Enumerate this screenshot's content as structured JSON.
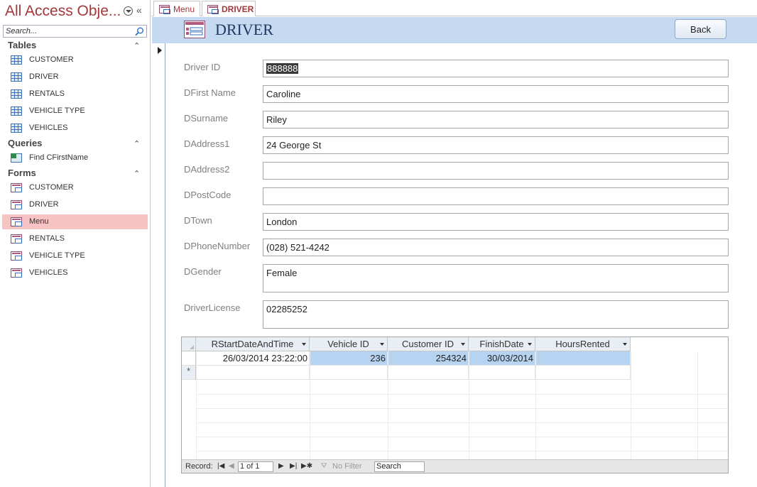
{
  "nav": {
    "title": "All Access Obje...",
    "search_placeholder": "Search...",
    "sections": [
      {
        "label": "Tables",
        "items": [
          {
            "label": "CUSTOMER",
            "icon": "table-icon"
          },
          {
            "label": "DRIVER",
            "icon": "table-icon"
          },
          {
            "label": "RENTALS",
            "icon": "table-icon"
          },
          {
            "label": "VEHICLE TYPE",
            "icon": "table-icon"
          },
          {
            "label": "VEHICLES",
            "icon": "table-icon"
          }
        ]
      },
      {
        "label": "Queries",
        "items": [
          {
            "label": "Find CFirstName",
            "icon": "query-icon"
          }
        ]
      },
      {
        "label": "Forms",
        "items": [
          {
            "label": "CUSTOMER",
            "icon": "form-icon"
          },
          {
            "label": "DRIVER",
            "icon": "form-icon"
          },
          {
            "label": "Menu",
            "icon": "form-icon",
            "selected": true
          },
          {
            "label": "RENTALS",
            "icon": "form-icon"
          },
          {
            "label": "VEHICLE TYPE",
            "icon": "form-icon"
          },
          {
            "label": "VEHICLES",
            "icon": "form-icon"
          }
        ]
      }
    ]
  },
  "tabs": [
    {
      "label": "Menu",
      "active": false
    },
    {
      "label": "DRIVER",
      "active": true
    }
  ],
  "form": {
    "title": "DRIVER",
    "back_label": "Back",
    "fields": [
      {
        "label": "Driver ID",
        "value": "888888",
        "selected": true
      },
      {
        "label": "DFirst Name",
        "value": "Caroline"
      },
      {
        "label": "DSurname",
        "value": "Riley"
      },
      {
        "label": "DAddress1",
        "value": "24 George St"
      },
      {
        "label": "DAddress2",
        "value": ""
      },
      {
        "label": "DPostCode",
        "value": ""
      },
      {
        "label": "DTown",
        "value": "London"
      },
      {
        "label": "DPhoneNumber",
        "value": "(028) 521-4242"
      },
      {
        "label": "DGender",
        "value": "Female"
      },
      {
        "label": "DriverLicense",
        "value": "02285252"
      }
    ]
  },
  "subform": {
    "columns": [
      "RStartDateAndTime",
      "Vehicle ID",
      "Customer ID",
      "FinishDate",
      "HoursRented"
    ],
    "rows": [
      [
        "26/03/2014 23:22:00",
        "236",
        "254324",
        "30/03/2014",
        ""
      ]
    ],
    "new_row_marker": "*",
    "navbar": {
      "record_label": "Record:",
      "position": "1 of 1",
      "filter_label": "No Filter",
      "search_label": "Search"
    }
  },
  "colors": {
    "accent": "#a4373a",
    "header_bg": "#c5d9f1",
    "selected_nav": "#f7c3c3",
    "cell_highlight": "#b6d4f2"
  }
}
